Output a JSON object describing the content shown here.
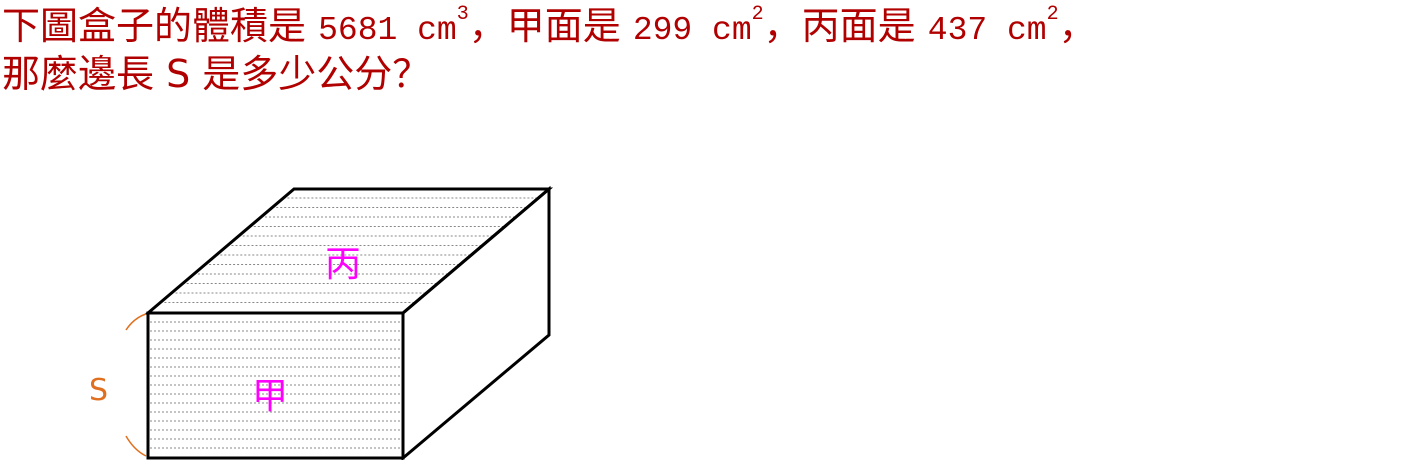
{
  "question": {
    "line1": {
      "part1": "下圖盒子的體積是 ",
      "volume": "5681 cm",
      "volume_exp": "3",
      "part2": "，甲面是 ",
      "area_jia": "299 cm",
      "area_jia_exp": "2",
      "part3": "，丙面是 ",
      "area_bing": "437 cm",
      "area_bing_exp": "2",
      "part4": "，"
    },
    "line2": "那麼邊長 S 是多少公分？"
  },
  "diagram": {
    "front_face_label": "甲",
    "top_face_label": "丙",
    "edge_label": "S",
    "colors": {
      "question_text": "#b00000",
      "face_label": "#ff00ff",
      "edge_label": "#e07020",
      "outline": "#000000",
      "hatch": "#888888"
    }
  }
}
